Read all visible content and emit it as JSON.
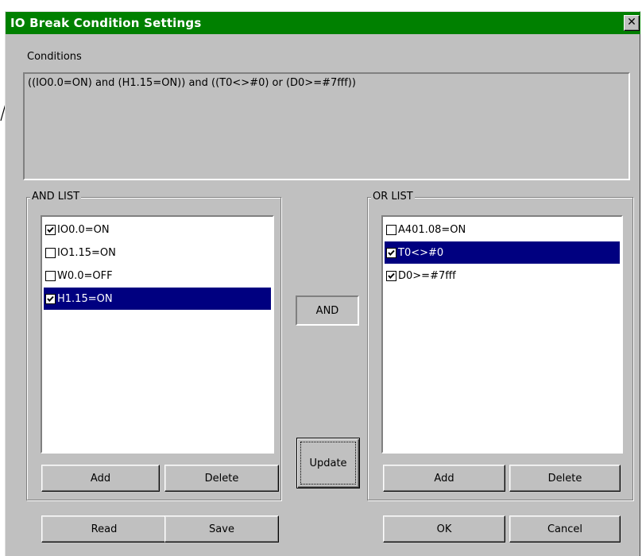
{
  "dialog": {
    "title": "IO Break Condition Settings",
    "close_glyph": "✕",
    "title_bar_color": "#008000",
    "face_color": "#c0c0c0",
    "selection_color": "#000080"
  },
  "conditions": {
    "label": "Conditions",
    "expression": "((IO0.0=ON) and (H1.15=ON)) and ((T0<>#0) or (D0>=#7fff))"
  },
  "and_list": {
    "title": "AND LIST",
    "items": [
      {
        "label": "IO0.0=ON",
        "checked": true,
        "selected": false
      },
      {
        "label": "IO1.15=ON",
        "checked": false,
        "selected": false
      },
      {
        "label": "W0.0=OFF",
        "checked": false,
        "selected": false
      },
      {
        "label": "H1.15=ON",
        "checked": true,
        "selected": true
      }
    ],
    "add_label": "Add",
    "delete_label": "Delete"
  },
  "or_list": {
    "title": "OR LIST",
    "items": [
      {
        "label": "A401.08=ON",
        "checked": false,
        "selected": false
      },
      {
        "label": "T0<>#0",
        "checked": true,
        "selected": true
      },
      {
        "label": "D0>=#7fff",
        "checked": true,
        "selected": false
      }
    ],
    "add_label": "Add",
    "delete_label": "Delete"
  },
  "operator": {
    "label": "AND"
  },
  "update_label": "Update",
  "footer": {
    "read_label": "Read",
    "save_label": "Save",
    "ok_label": "OK",
    "cancel_label": "Cancel"
  }
}
